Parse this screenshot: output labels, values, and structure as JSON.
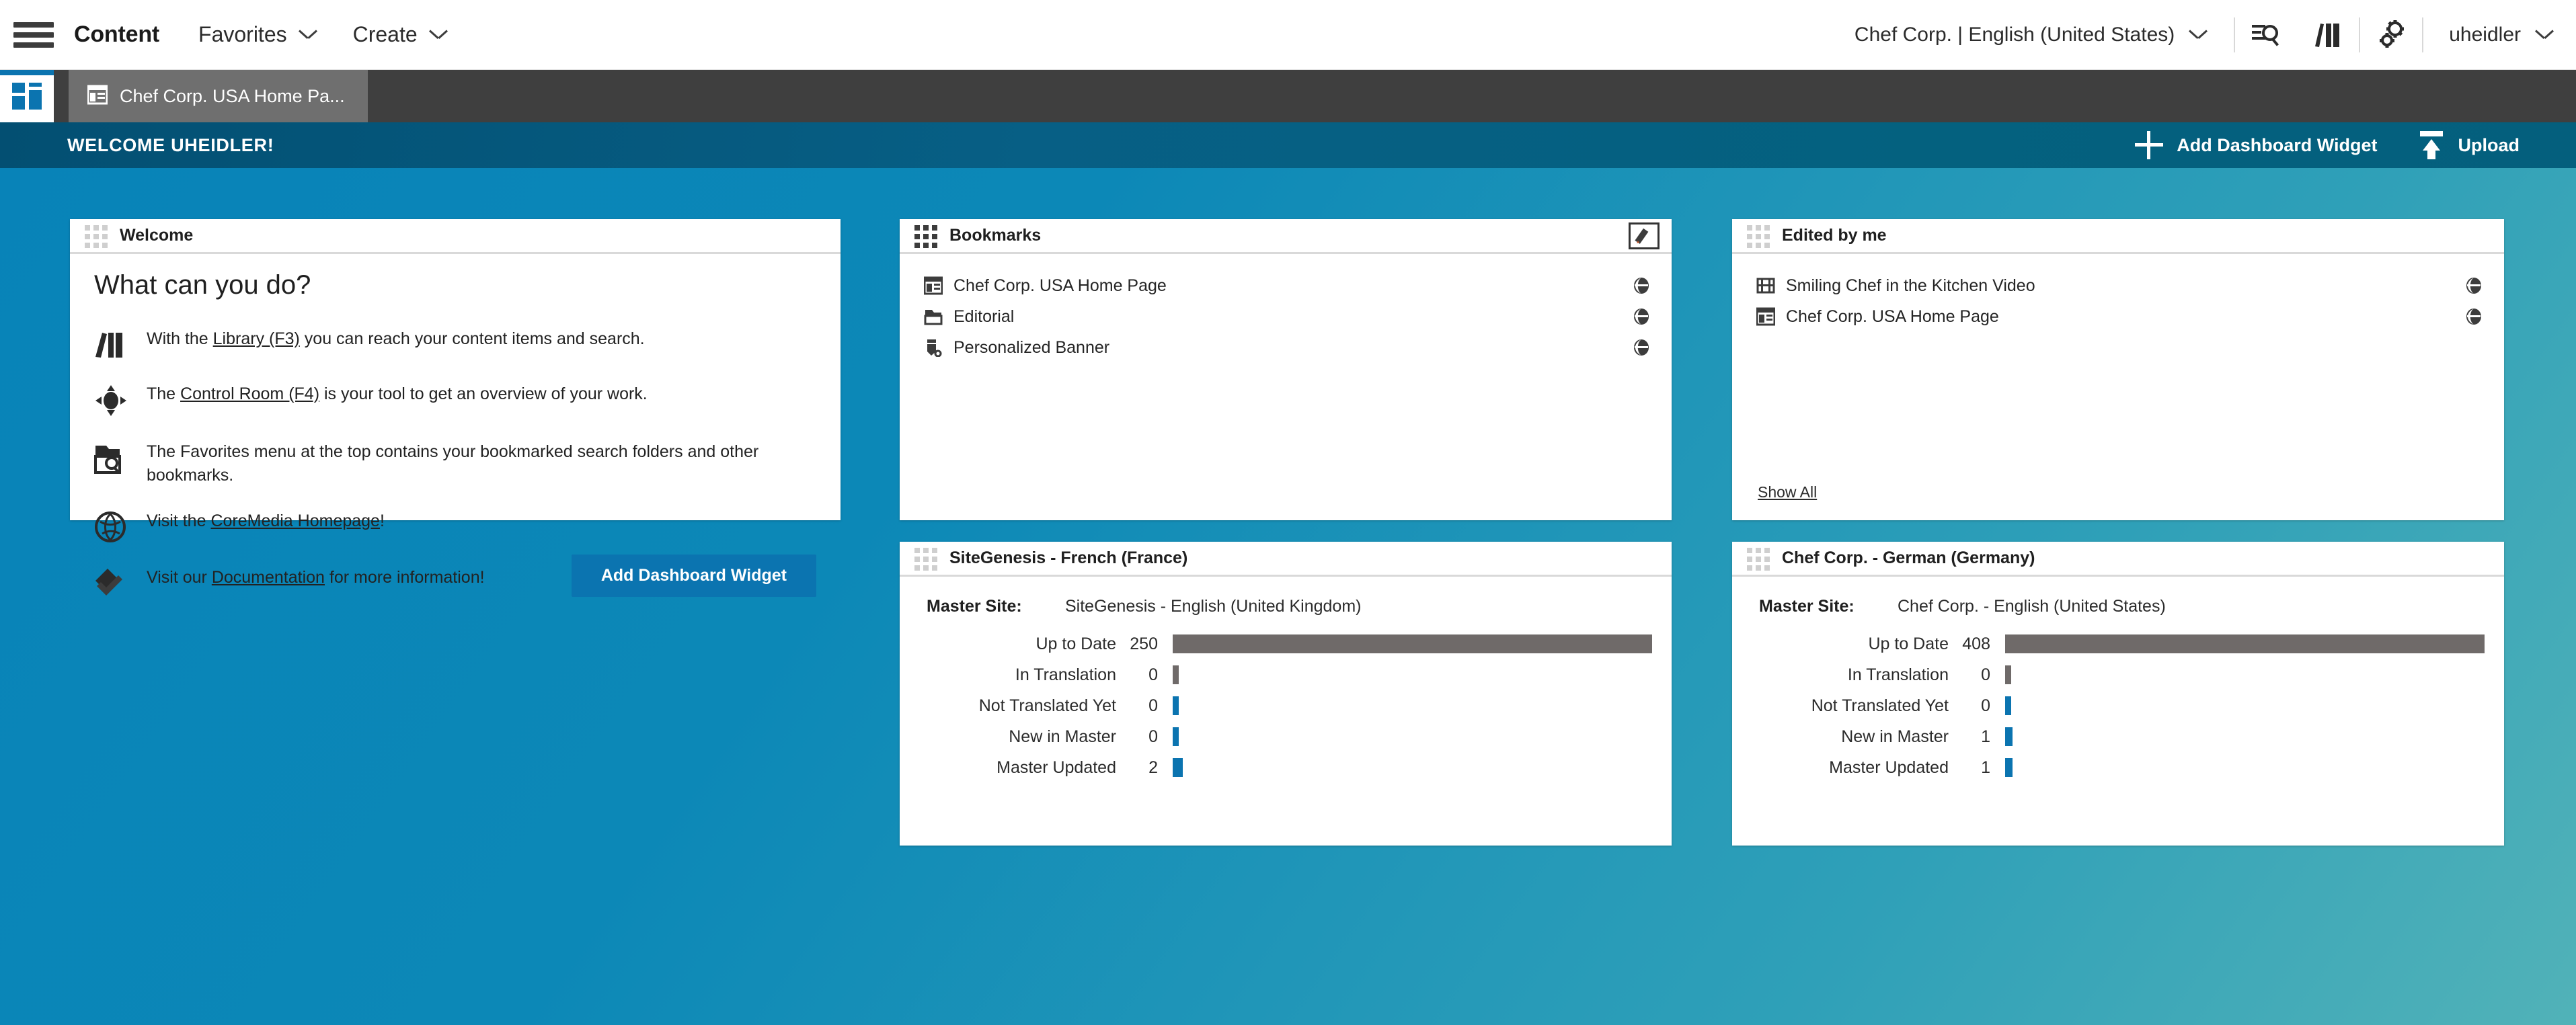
{
  "topbar": {
    "menu_icon": "hamburger-icon",
    "title": "Content",
    "items": [
      {
        "label": "Favorites",
        "icon": "chevron-down-icon"
      },
      {
        "label": "Create",
        "icon": "chevron-down-icon"
      }
    ],
    "site_selector": "Chef Corp. | English (United States)",
    "icons": [
      "search-icon",
      "library-icon",
      "gear-icon"
    ],
    "user": "uheidler"
  },
  "tabs": {
    "home_tab_icon": "dashboard-icon",
    "open_tabs": [
      {
        "label": "Chef Corp. USA Home Pa...",
        "icon": "page-icon"
      }
    ]
  },
  "welcomebar": {
    "greeting": "WELCOME UHEIDLER!",
    "add_widget_label": "Add Dashboard Widget",
    "upload_label": "Upload"
  },
  "widgets": {
    "welcome": {
      "title": "Welcome",
      "heading": "What can you do?",
      "rows": [
        {
          "icon": "library-icon",
          "pre": "With the ",
          "link": "Library (F3)",
          "post": " you can reach your content items and search."
        },
        {
          "icon": "control-room-icon",
          "pre": "The ",
          "link": "Control Room (F4)",
          "post": " is your tool to get an overview of your work."
        },
        {
          "icon": "search-folder-icon",
          "pre": "The Favorites menu at the top contains your bookmarked search folders and other bookmarks.",
          "link": "",
          "post": ""
        },
        {
          "icon": "globe-icon",
          "pre": "Visit the ",
          "link": "CoreMedia Homepage",
          "post": "!"
        },
        {
          "icon": "documentation-icon",
          "pre": "Visit our ",
          "link": "Documentation",
          "post": " for more information!"
        }
      ],
      "button_label": "Add Dashboard Widget"
    },
    "bookmarks": {
      "title": "Bookmarks",
      "edit_icon": "pencil-icon",
      "items": [
        {
          "label": "Chef Corp. USA Home Page",
          "icon": "page-icon",
          "status_icon": "publication-state-icon"
        },
        {
          "label": "Editorial",
          "icon": "folder-icon",
          "status_icon": "publication-state-icon"
        },
        {
          "label": "Personalized Banner",
          "icon": "banner-icon",
          "status_icon": "publication-state-icon"
        }
      ]
    },
    "edited_by_me": {
      "title": "Edited by me",
      "items": [
        {
          "label": "Smiling Chef in the Kitchen Video",
          "icon": "video-icon",
          "status_icon": "publication-state-icon"
        },
        {
          "label": "Chef Corp. USA Home Page",
          "icon": "page-icon",
          "status_icon": "publication-state-icon"
        }
      ],
      "show_all_label": "Show All"
    },
    "sitegenesis": {
      "title": "SiteGenesis - French (France)",
      "master_site_label": "Master Site:",
      "master_site_value": "SiteGenesis - English (United Kingdom)"
    },
    "chefcorp": {
      "title": "Chef Corp. - German (Germany)",
      "master_site_label": "Master Site:",
      "master_site_value": "Chef Corp. - English (United States)"
    }
  },
  "chart_data": [
    {
      "type": "bar",
      "title": "SiteGenesis - French (France)",
      "orientation": "horizontal",
      "categories": [
        "Up to Date",
        "In Translation",
        "Not Translated Yet",
        "New in Master",
        "Master Updated"
      ],
      "values": [
        250,
        0,
        0,
        0,
        2
      ],
      "colors": [
        "#6f6a69",
        "#6f6a69",
        "#0b74b0",
        "#0b74b0",
        "#0b74b0"
      ],
      "xlabel": "",
      "ylabel": "",
      "xlim": [
        0,
        250
      ],
      "grid": false,
      "legend": false
    },
    {
      "type": "bar",
      "title": "Chef Corp. - German (Germany)",
      "orientation": "horizontal",
      "categories": [
        "Up to Date",
        "In Translation",
        "Not Translated Yet",
        "New in Master",
        "Master Updated"
      ],
      "values": [
        408,
        0,
        0,
        1,
        1
      ],
      "colors": [
        "#6f6a69",
        "#6f6a69",
        "#0b74b0",
        "#0b74b0",
        "#0b74b0"
      ],
      "xlabel": "",
      "ylabel": "",
      "xlim": [
        0,
        408
      ],
      "grid": false,
      "legend": false
    }
  ],
  "theme": {
    "accent": "#0b74b0",
    "desktop_start": "#0883b8",
    "desktop_end": "#51b2b8",
    "welcomebar": "#04617f",
    "tabstrip": "#3f3f3f"
  }
}
